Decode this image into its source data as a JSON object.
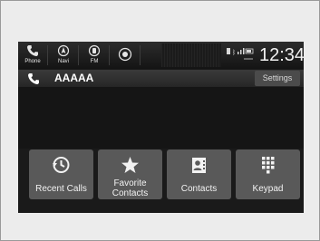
{
  "status_bar": {
    "sources": [
      {
        "label": "Phone",
        "icon": "phone-icon"
      },
      {
        "label": "Navi",
        "icon": "navi-icon"
      },
      {
        "label": "FM",
        "icon": "fm-icon"
      },
      {
        "label": "",
        "icon": "radio-icon"
      }
    ],
    "clock": "12:34"
  },
  "call_bar": {
    "caller_name": "AAAAA",
    "settings_label": "Settings"
  },
  "buttons": [
    {
      "label": "Recent Calls",
      "icon": "history-icon"
    },
    {
      "label": "Favorite Contacts",
      "icon": "star-icon"
    },
    {
      "label": "Contacts",
      "icon": "contacts-icon"
    },
    {
      "label": "Keypad",
      "icon": "keypad-icon"
    }
  ],
  "colors": {
    "screen_bg": "#1a1a1a",
    "button_bg": "#595959",
    "text": "#f2f2f2"
  }
}
